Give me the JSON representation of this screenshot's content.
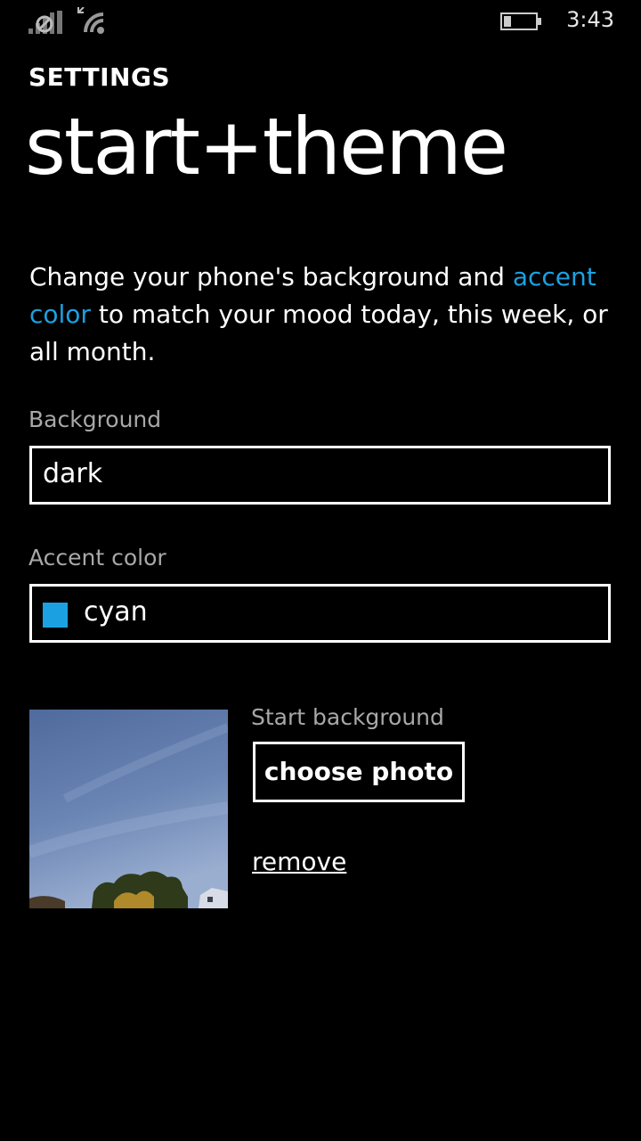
{
  "status_bar": {
    "time": "3:43",
    "icons": [
      "cellular-signal-icon",
      "wifi-icon",
      "battery-icon"
    ]
  },
  "header": {
    "app_title": "SETTINGS",
    "page_title": "start+theme"
  },
  "description": {
    "before": "Change your phone's background and ",
    "link": "accent color",
    "after": " to match your mood today, this week, or all month."
  },
  "background": {
    "label": "Background",
    "value": "dark"
  },
  "accent": {
    "label": "Accent color",
    "value": "cyan",
    "swatch_color": "#1ba1e2"
  },
  "start_background": {
    "label": "Start background",
    "choose_label": "choose photo",
    "remove_label": "remove"
  },
  "colors": {
    "accent": "#1ba1e2",
    "background": "#000000",
    "secondary_text": "#a8a8a8"
  }
}
